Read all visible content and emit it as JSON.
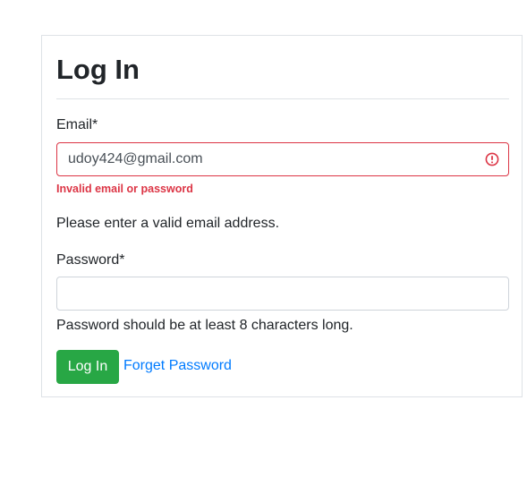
{
  "form": {
    "title": "Log In",
    "email_label": "Email*",
    "email_value": "udoy424@gmail.com",
    "email_error": "Invalid email or password",
    "email_help": "Please enter a valid email address.",
    "password_label": "Password*",
    "password_value": "",
    "password_help": "Password should be at least 8 characters long.",
    "login_button": "Log In",
    "forget_link": "Forget Password"
  },
  "icons": {
    "email_status": "exclamation-circle-icon"
  },
  "colors": {
    "error": "#dc3545",
    "success_button": "#28a745",
    "link": "#007bff",
    "border": "#ced4da"
  }
}
